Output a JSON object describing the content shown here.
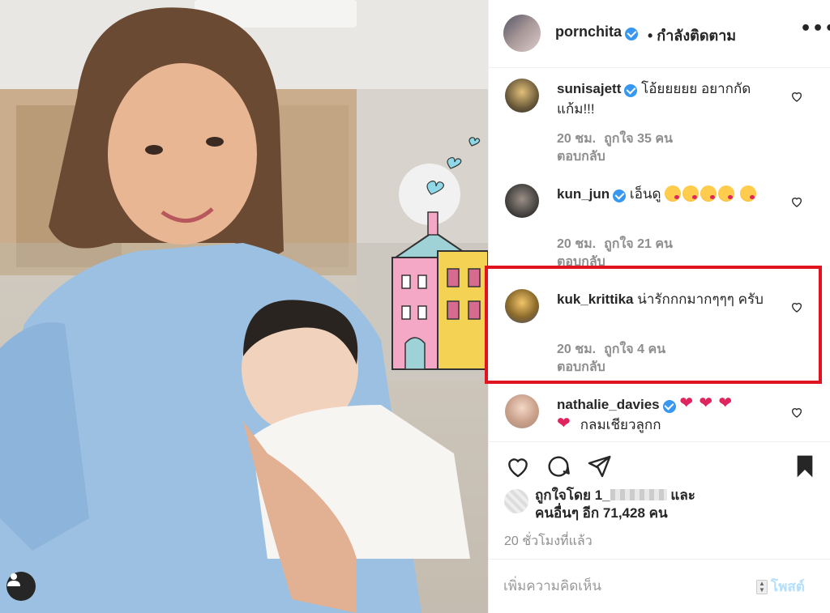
{
  "header": {
    "username": "pornchita",
    "follow_status": "• กำลังติดตาม",
    "more_label": "•••"
  },
  "comments": [
    {
      "user": "sunisajett",
      "verified": true,
      "text": "โอ้ยยยยย อยากกัดแก้ม!!!",
      "time": "20 ชม.",
      "likes": "ถูกใจ 35 คน",
      "reply": "ตอบกลับ"
    },
    {
      "user": "kun_jun",
      "verified": true,
      "text": "เอ็นดู",
      "emojis": [
        "kiss",
        "kiss",
        "kiss",
        "kiss",
        "kiss"
      ],
      "time": "20 ชม.",
      "likes": "ถูกใจ 21 คน",
      "reply": "ตอบกลับ"
    },
    {
      "user": "kuk_krittika",
      "verified": false,
      "text": "น่ารักกกมากๆๆๆ ครับ",
      "time": "20 ชม.",
      "likes": "ถูกใจ 4 คน",
      "reply": "ตอบกลับ"
    },
    {
      "user": "nathalie_davies",
      "verified": true,
      "emojis": [
        "heart",
        "heart",
        "heart",
        "heart"
      ],
      "text": "กลมเชียวลูกก"
    }
  ],
  "likes": {
    "liked_by_prefix": "ถูกใจโดย 1_",
    "liked_by_suffix": "และ",
    "others": "คนอื่นๆ อีก 71,428 คน"
  },
  "time_ago": "20 ชั่วโมงที่แล้ว",
  "add_comment": {
    "placeholder": "เพิ่มความคิดเห็น",
    "post_label": "โพสต์"
  },
  "colors": {
    "verified": "#3897f0",
    "highlight": "#e0141e",
    "muted_text": "#8e8e8e",
    "post_button": "#b2dffc"
  }
}
